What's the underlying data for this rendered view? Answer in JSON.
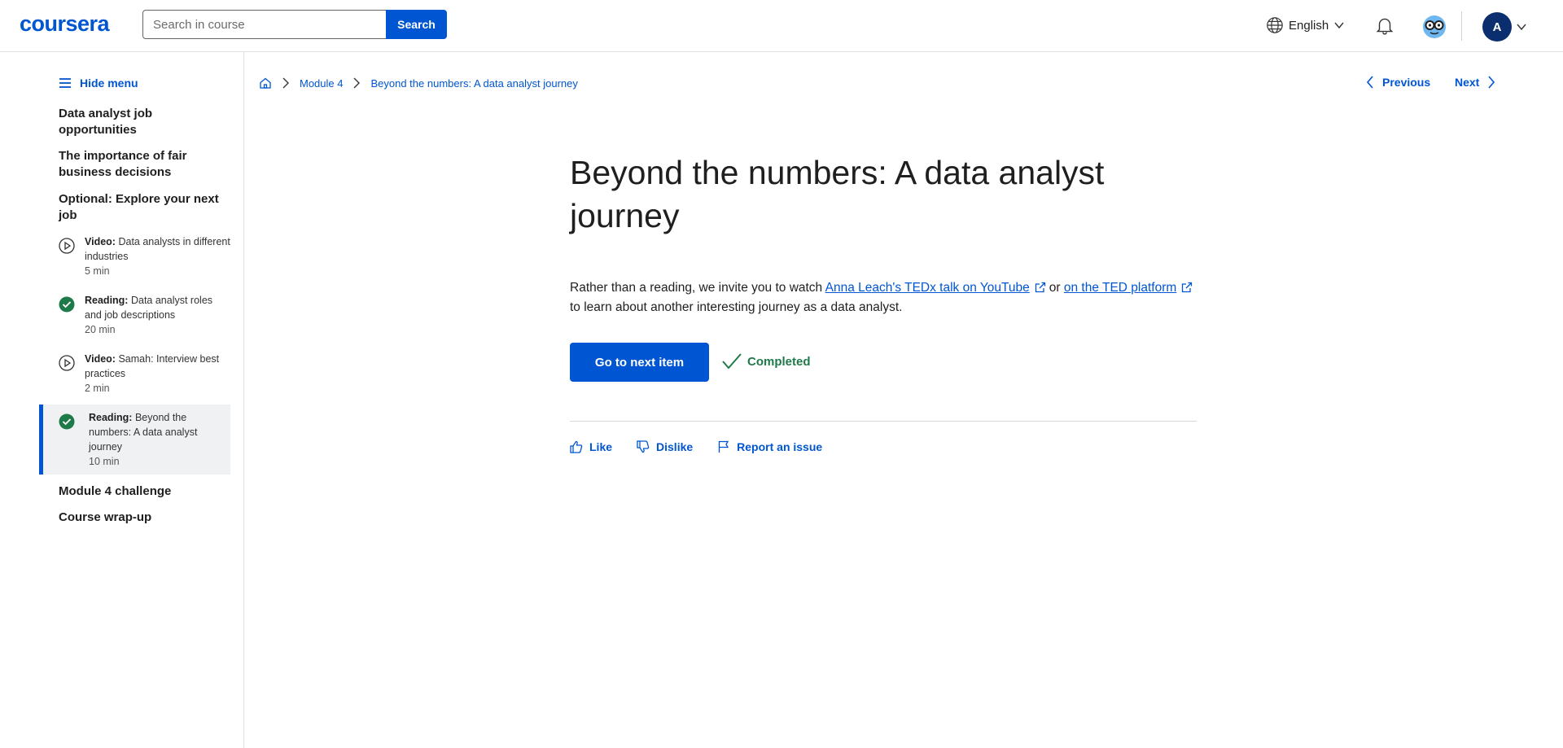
{
  "header": {
    "logo": "coursera",
    "search_placeholder": "Search in course",
    "search_button": "Search",
    "language": "English",
    "avatar_initial": "A"
  },
  "sidebar": {
    "hide_menu": "Hide menu",
    "sections": [
      "Data analyst job opportunities",
      "The importance of fair business decisions",
      "Optional: Explore your next job"
    ],
    "items": [
      {
        "type": "Video:",
        "title": "Data analysts in different industries",
        "duration": "5 min",
        "status": "video"
      },
      {
        "type": "Reading:",
        "title": "Data analyst roles and job descriptions",
        "duration": "20 min",
        "status": "completed"
      },
      {
        "type": "Video:",
        "title": "Samah: Interview best practices",
        "duration": "2 min",
        "status": "video"
      },
      {
        "type": "Reading:",
        "title": "Beyond the numbers: A data analyst journey",
        "duration": "10 min",
        "status": "completed"
      }
    ],
    "sections_after": [
      "Module 4 challenge",
      "Course wrap-up"
    ]
  },
  "breadcrumb": {
    "module": "Module 4",
    "current": "Beyond the numbers: A data analyst journey"
  },
  "nav": {
    "previous": "Previous",
    "next": "Next"
  },
  "content": {
    "title": "Beyond the numbers: A data analyst journey",
    "para_start": "Rather than a reading, we invite you to watch ",
    "link1": "Anna Leach's TEDx talk on YouTube",
    "para_mid": "or ",
    "link2": "on the TED platform",
    "para_end": "to learn about another interesting journey as a data analyst.",
    "next_button": "Go to next item",
    "completed": "Completed",
    "like": "Like",
    "dislike": "Dislike",
    "report": "Report an issue"
  },
  "colors": {
    "brand": "#0056d2",
    "success": "#1f7a4a"
  }
}
